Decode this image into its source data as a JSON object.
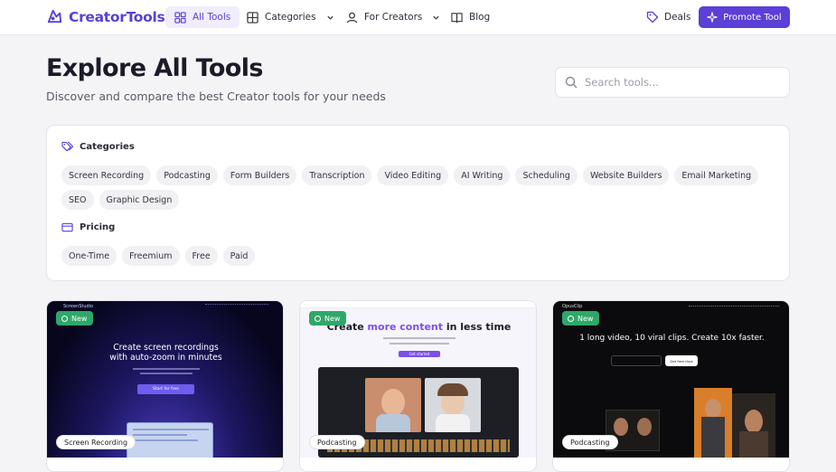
{
  "brand": {
    "name": "CreatorTools",
    "color": "#5b3fd6"
  },
  "nav": {
    "items": [
      {
        "label": "All Tools",
        "icon": "grid-icon",
        "active": true
      },
      {
        "label": "Categories",
        "icon": "category-grid-icon",
        "dropdown": true
      },
      {
        "label": "For Creators",
        "icon": "user-icon",
        "dropdown": true
      },
      {
        "label": "Blog",
        "icon": "book-icon"
      }
    ],
    "deals_label": "Deals",
    "promote_label": "Promote Tool"
  },
  "hero": {
    "title": "Explore All Tools",
    "subtitle": "Discover and compare the best Creator tools for your needs"
  },
  "search": {
    "placeholder": "Search tools...",
    "value": ""
  },
  "filters": {
    "categories_title": "Categories",
    "categories": [
      "Screen Recording",
      "Podcasting",
      "Form Builders",
      "Transcription",
      "Video Editing",
      "AI Writing",
      "Scheduling",
      "Website Builders",
      "Email Marketing",
      "SEO",
      "Graphic Design"
    ],
    "pricing_title": "Pricing",
    "pricing": [
      "One-Time",
      "Freemium",
      "Free",
      "Paid"
    ]
  },
  "cards": [
    {
      "badge": "New",
      "category": "Screen Recording",
      "preview": {
        "brand": "ScreenStudio",
        "headline_1": "Create screen recordings",
        "headline_2": "with auto-zoom in minutes",
        "button": "Start for free"
      }
    },
    {
      "badge": "New",
      "category": "Podcasting",
      "preview": {
        "brand": "Riverside",
        "headline_start": "Create ",
        "headline_accent": "more content",
        "headline_end": " in less time",
        "button": "Get started"
      }
    },
    {
      "badge": "New",
      "category": "Podcasting",
      "preview": {
        "brand": "OpusClip",
        "headline": "1 long video, 10 viral clips. Create 10x faster.",
        "button": "Get free clips"
      }
    }
  ]
}
